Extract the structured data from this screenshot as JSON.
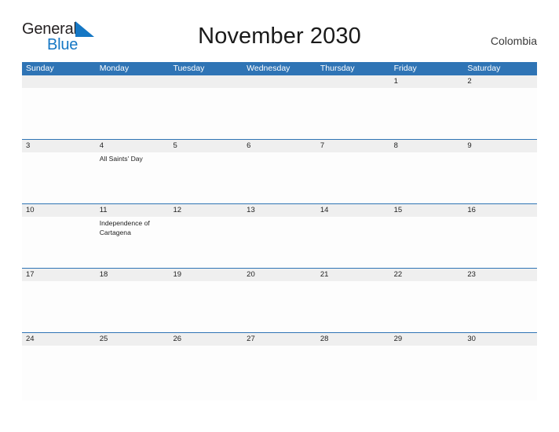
{
  "brand": {
    "name_part1": "General",
    "name_part2": "Blue",
    "sail_icon": "sail-triangle-icon",
    "color_dark": "#231f20",
    "color_blue": "#1577c4"
  },
  "header": {
    "title": "November 2030",
    "country": "Colombia",
    "accent_color": "#2f74b5",
    "date_band_color": "#efefef"
  },
  "weekdays": [
    "Sunday",
    "Monday",
    "Tuesday",
    "Wednesday",
    "Thursday",
    "Friday",
    "Saturday"
  ],
  "weeks": [
    {
      "days": [
        {
          "date": "",
          "event": ""
        },
        {
          "date": "",
          "event": ""
        },
        {
          "date": "",
          "event": ""
        },
        {
          "date": "",
          "event": ""
        },
        {
          "date": "",
          "event": ""
        },
        {
          "date": "1",
          "event": ""
        },
        {
          "date": "2",
          "event": ""
        }
      ]
    },
    {
      "days": [
        {
          "date": "3",
          "event": ""
        },
        {
          "date": "4",
          "event": "All Saints' Day"
        },
        {
          "date": "5",
          "event": ""
        },
        {
          "date": "6",
          "event": ""
        },
        {
          "date": "7",
          "event": ""
        },
        {
          "date": "8",
          "event": ""
        },
        {
          "date": "9",
          "event": ""
        }
      ]
    },
    {
      "days": [
        {
          "date": "10",
          "event": ""
        },
        {
          "date": "11",
          "event": "Independence of Cartagena"
        },
        {
          "date": "12",
          "event": ""
        },
        {
          "date": "13",
          "event": ""
        },
        {
          "date": "14",
          "event": ""
        },
        {
          "date": "15",
          "event": ""
        },
        {
          "date": "16",
          "event": ""
        }
      ]
    },
    {
      "days": [
        {
          "date": "17",
          "event": ""
        },
        {
          "date": "18",
          "event": ""
        },
        {
          "date": "19",
          "event": ""
        },
        {
          "date": "20",
          "event": ""
        },
        {
          "date": "21",
          "event": ""
        },
        {
          "date": "22",
          "event": ""
        },
        {
          "date": "23",
          "event": ""
        }
      ]
    },
    {
      "days": [
        {
          "date": "24",
          "event": ""
        },
        {
          "date": "25",
          "event": ""
        },
        {
          "date": "26",
          "event": ""
        },
        {
          "date": "27",
          "event": ""
        },
        {
          "date": "28",
          "event": ""
        },
        {
          "date": "29",
          "event": ""
        },
        {
          "date": "30",
          "event": ""
        }
      ]
    }
  ]
}
